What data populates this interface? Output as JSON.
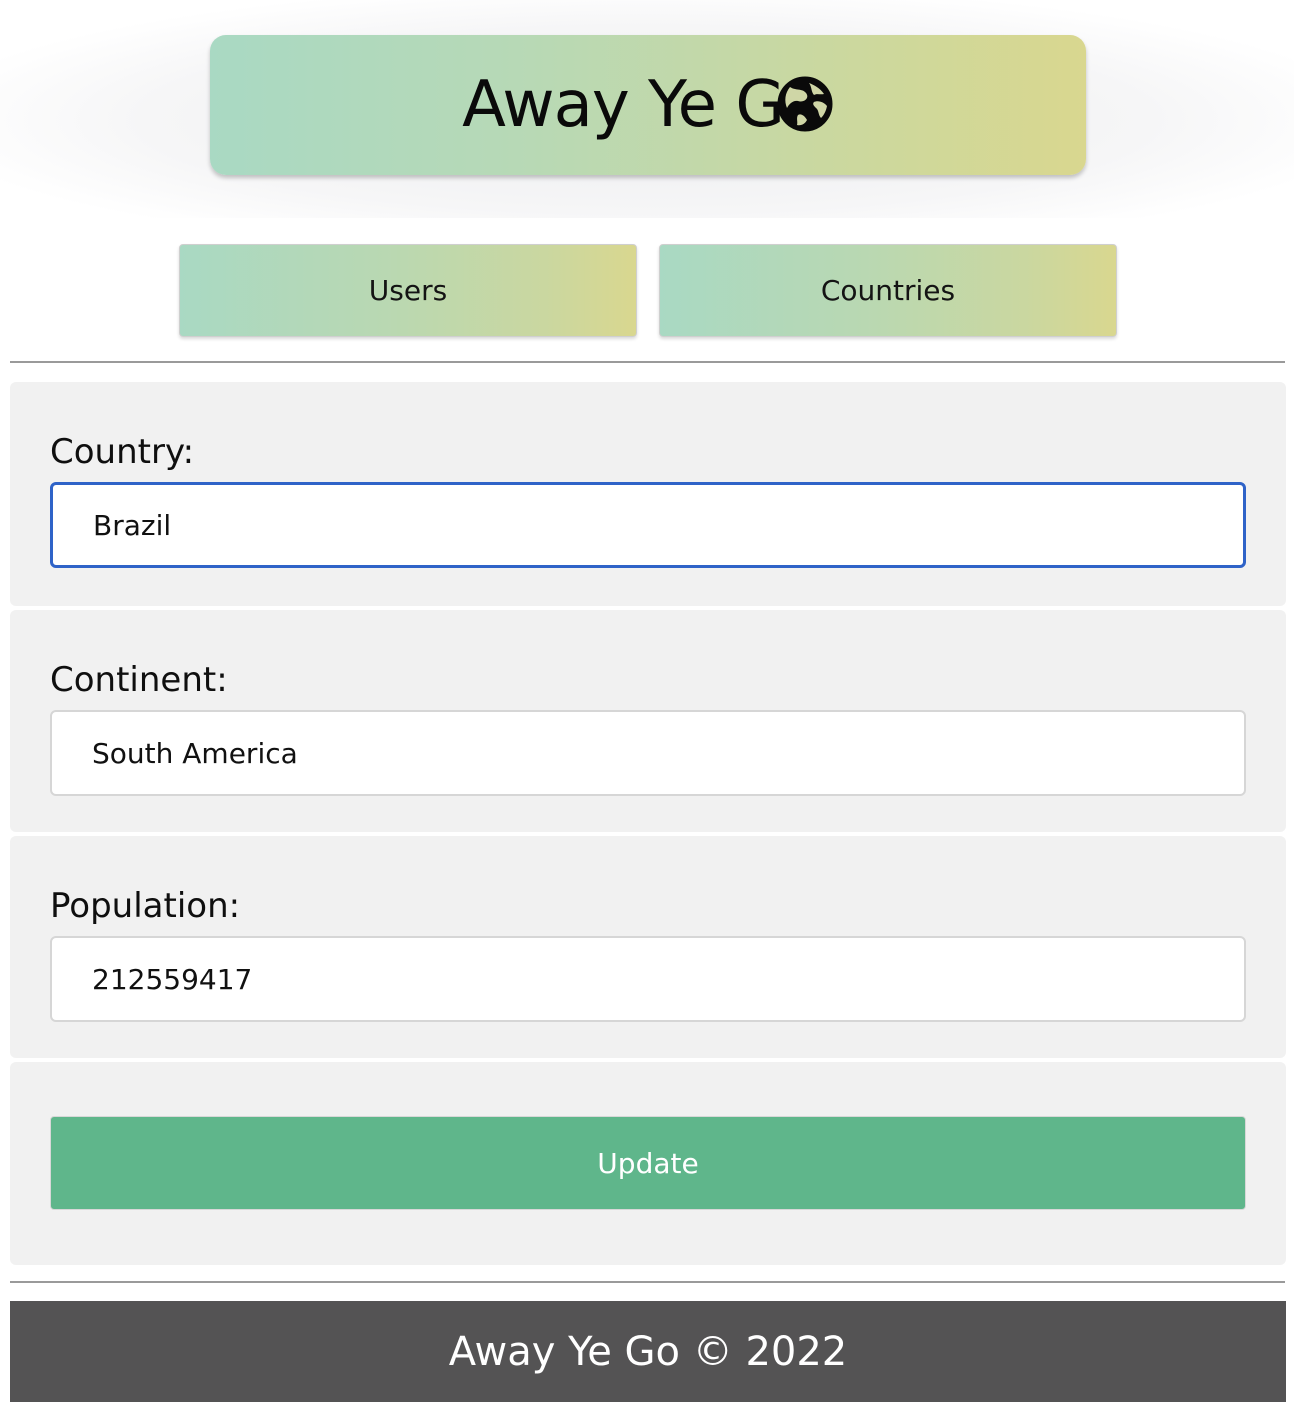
{
  "header": {
    "brand_text": "Away Ye G",
    "brand_icon": "globe-icon"
  },
  "nav": {
    "users_label": "Users",
    "countries_label": "Countries"
  },
  "form": {
    "country": {
      "label": "Country:",
      "value": "Brazil"
    },
    "continent": {
      "label": "Continent:",
      "value": "South America"
    },
    "population": {
      "label": "Population:",
      "value": "212559417"
    },
    "submit_label": "Update"
  },
  "footer": {
    "text": "Away Ye Go © 2022"
  },
  "colors": {
    "brand_gradient_start": "#a9d9c3",
    "brand_gradient_end": "#d9d78f",
    "focus_border": "#2f63c8",
    "submit_bg": "#5fb68b",
    "footer_bg": "#545354"
  }
}
